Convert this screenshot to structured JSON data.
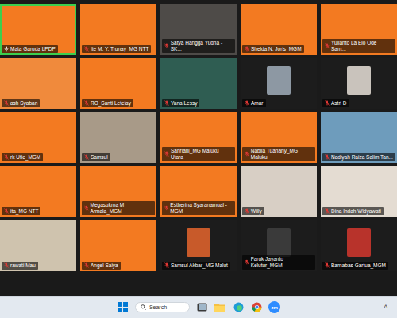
{
  "gallery": {
    "participants": [
      {
        "name": "Mata Garuda LPDP",
        "muted": false,
        "speaking": true,
        "kind": "video",
        "color": "#f37a21"
      },
      {
        "name": "Ite M. Y. Trunay_MG NTT",
        "muted": true,
        "speaking": false,
        "kind": "video",
        "color": "#f37a21"
      },
      {
        "name": "Satya Hangga Yudha - SK...",
        "muted": true,
        "speaking": false,
        "kind": "video",
        "color": "#4e4b48"
      },
      {
        "name": "Shelda N. Joris_MGM",
        "muted": true,
        "speaking": false,
        "kind": "video",
        "color": "#f37a21"
      },
      {
        "name": "Yulianto La Elo Ode Sam...",
        "muted": true,
        "speaking": false,
        "kind": "video",
        "color": "#f37a21"
      },
      {
        "name": "ash Syaban",
        "muted": true,
        "speaking": false,
        "kind": "video",
        "color": "#f08a3c"
      },
      {
        "name": "RO_Santi Letelay",
        "muted": true,
        "speaking": false,
        "kind": "video",
        "color": "#f37a21"
      },
      {
        "name": "Yana Lessy",
        "muted": true,
        "speaking": false,
        "kind": "video",
        "color": "#2f5d52"
      },
      {
        "name": "Amar",
        "muted": true,
        "speaking": false,
        "kind": "avatar",
        "color": "#8d98a3"
      },
      {
        "name": "Astri D",
        "muted": true,
        "speaking": false,
        "kind": "avatar",
        "color": "#c9c3bc"
      },
      {
        "name": "rk Ufie_MGM",
        "muted": true,
        "speaking": false,
        "kind": "video",
        "color": "#f37a21"
      },
      {
        "name": "Samsul",
        "muted": true,
        "speaking": false,
        "kind": "video",
        "color": "#a89a88"
      },
      {
        "name": "Sahriani_MG Maluku Utara",
        "muted": true,
        "speaking": false,
        "kind": "video",
        "color": "#f37a21"
      },
      {
        "name": "Nabila Tuanany_MG Maluku",
        "muted": true,
        "speaking": false,
        "kind": "video",
        "color": "#f37a21"
      },
      {
        "name": "Nadiyah Raiza Salim Tan...",
        "muted": true,
        "speaking": false,
        "kind": "video",
        "color": "#6e9cbc"
      },
      {
        "name": "ita_MG NTT",
        "muted": true,
        "speaking": false,
        "kind": "video",
        "color": "#f37a21"
      },
      {
        "name": "Megasukma M Armala_MGM",
        "muted": true,
        "speaking": false,
        "kind": "video",
        "color": "#f37a21"
      },
      {
        "name": "Estherina Syaranamual - MGM",
        "muted": true,
        "speaking": false,
        "kind": "video",
        "color": "#f37a21"
      },
      {
        "name": "Willy",
        "muted": true,
        "speaking": false,
        "kind": "video",
        "color": "#d8cfc5"
      },
      {
        "name": "Dina Indah Widyawati",
        "muted": true,
        "speaking": false,
        "kind": "video",
        "color": "#e4dcd2"
      },
      {
        "name": "rawati Mau",
        "muted": true,
        "speaking": false,
        "kind": "video",
        "color": "#cfc3ae"
      },
      {
        "name": "Angel Saiya",
        "muted": true,
        "speaking": false,
        "kind": "video",
        "color": "#f37a21"
      },
      {
        "name": "Samsul Akbar_MG Malut",
        "muted": true,
        "speaking": false,
        "kind": "avatar",
        "color": "#c85a2a"
      },
      {
        "name": "Faruk Jayanto Kelutur_MGM",
        "muted": true,
        "speaking": false,
        "kind": "avatar",
        "color": "#3a3a3a"
      },
      {
        "name": "Barnabas Gartua_MGM",
        "muted": true,
        "speaking": false,
        "kind": "avatar",
        "color": "#b8332b"
      }
    ]
  },
  "taskbar": {
    "search_placeholder": "Search",
    "zoom_label": "zm",
    "tray_chevron": "^"
  }
}
